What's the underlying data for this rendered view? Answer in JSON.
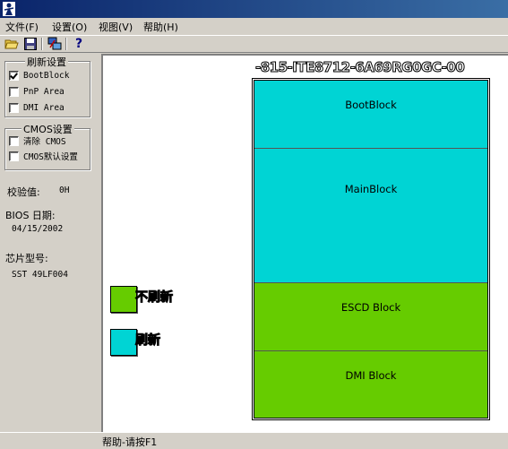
{
  "window": {
    "title": ""
  },
  "menu": {
    "items": [
      "文件(F)",
      "设置(O)",
      "视图(V)",
      "帮助(H)"
    ]
  },
  "toolbar": {
    "buttons": [
      "open-folder-icon",
      "save-icon",
      "network-icon",
      "help-icon"
    ],
    "help_glyph": "?"
  },
  "refresh_settings": {
    "title": "刷新设置",
    "options": [
      {
        "label": "BootBlock",
        "checked": true
      },
      {
        "label": "PnP Area",
        "checked": false
      },
      {
        "label": "DMI Area",
        "checked": false
      }
    ]
  },
  "cmos_settings": {
    "title": "CMOS设置",
    "options": [
      {
        "label": "清除 CMOS",
        "checked": false
      },
      {
        "label": "CMOS默认设置",
        "checked": false
      }
    ]
  },
  "info": {
    "checksum_label": "校验值:",
    "checksum_value": "0H",
    "bios_date_label": "BIOS 日期:",
    "bios_date_value": "04/15/2002",
    "chip_model_label": "芯片型号:",
    "chip_model_value": "SST 49LF004"
  },
  "chip": {
    "label": "-815-ITE8712-6A69RG0GC-00",
    "blocks": [
      {
        "name": "BootBlock",
        "color": "#00d4d4",
        "state": "refresh"
      },
      {
        "name": "MainBlock",
        "color": "#00d4d4",
        "state": "refresh"
      },
      {
        "name": "ESCD Block",
        "color": "#66cc00",
        "state": "no-refresh"
      },
      {
        "name": "DMI Block",
        "color": "#66cc00",
        "state": "no-refresh"
      }
    ]
  },
  "legend": {
    "no_refresh": {
      "label": "不刷新",
      "color": "#66cc00"
    },
    "refresh": {
      "label": "刷新",
      "color": "#00d4d4"
    }
  },
  "status": {
    "text": "帮助-请按F1"
  },
  "colors": {
    "titlebar_start": "#0a246a",
    "titlebar_end": "#3a6ea5",
    "refresh": "#00d4d4",
    "no_refresh": "#66cc00"
  }
}
